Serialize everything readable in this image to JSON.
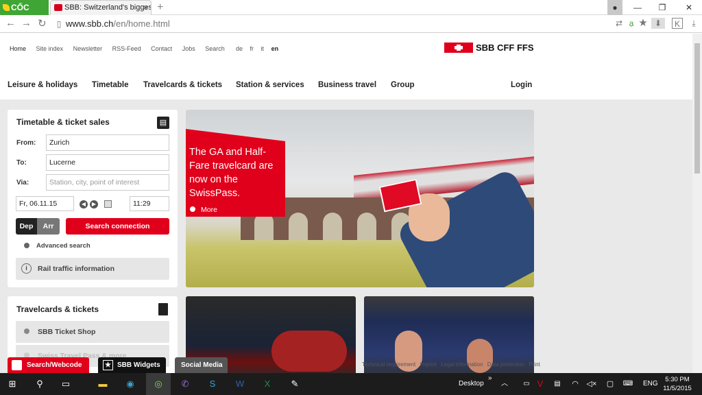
{
  "browser": {
    "logo": "CỐC CỐC",
    "tab_title": "SBB: Switzerland's biggest",
    "tab_close": "×",
    "new_tab": "+",
    "url_host": "www.sbb.ch",
    "url_path": "/en/home.html",
    "back": "←",
    "forward": "→",
    "reload": "↻",
    "minimize": "—",
    "restore": "❐",
    "close": "✕"
  },
  "utility_nav": [
    "Home",
    "Site index",
    "Newsletter",
    "RSS-Feed",
    "Contact",
    "Jobs",
    "Search"
  ],
  "languages": [
    "de",
    "fr",
    "it",
    "en"
  ],
  "brand": "SBB CFF FFS",
  "main_nav": [
    "Leisure & holidays",
    "Timetable",
    "Travelcards & tickets",
    "Station & services",
    "Business travel",
    "Group"
  ],
  "login": "Login",
  "timetable": {
    "title": "Timetable & ticket sales",
    "from_label": "From:",
    "from_value": "Zurich",
    "to_label": "To:",
    "to_value": "Lucerne",
    "via_label": "Via:",
    "via_placeholder": "Station, city, point of interest",
    "date": "Fr, 06.11.15",
    "time": "11:29",
    "dep": "Dep",
    "arr": "Arr",
    "search_button": "Search connection",
    "advanced": "Advanced search",
    "rail_info": "Rail traffic information"
  },
  "travelcards": {
    "title": "Travelcards & tickets",
    "item1": "SBB Ticket Shop",
    "item2": "Swiss Travel Pass & more"
  },
  "hero": {
    "promo": "The GA and Half-Fare travelcard are now on the SwissPass.",
    "more": "More"
  },
  "footer_links": [
    "Technical requirement",
    "Imprint",
    "Legal information",
    "Data protection",
    "Print"
  ],
  "bottom_buttons": {
    "search": "Search/Webcode",
    "widgets": "SBB Widgets",
    "social": "Social Media"
  },
  "taskbar": {
    "desktop": "Desktop",
    "lang": "ENG",
    "time": "5:30 PM",
    "date": "11/5/2015"
  },
  "colors": {
    "sbb_red": "#e0001b",
    "coccoc_green": "#3fa535"
  }
}
